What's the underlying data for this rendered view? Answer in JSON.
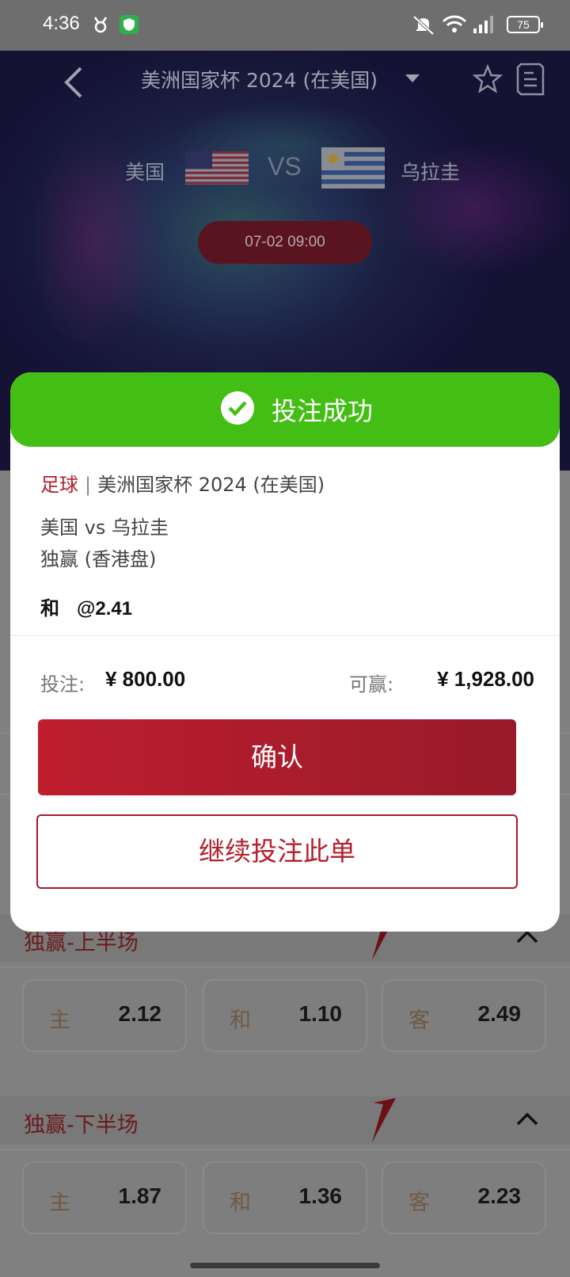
{
  "status_bar": {
    "time": "4:36",
    "battery": "75"
  },
  "header": {
    "league_title": "美洲国家杯 2024 (在美国)",
    "home_team": "美国",
    "vs": "VS",
    "away_team": "乌拉圭",
    "datetime": "07-02 09:00"
  },
  "modal": {
    "title": "投注成功",
    "sport": "足球",
    "separator": "|",
    "league": "美洲国家杯 2024 (在美国)",
    "match": "美国 vs 乌拉圭",
    "market": "独赢 (香港盘)",
    "selection": "和",
    "odds": "@2.41",
    "stake_label": "投注:",
    "stake_value": "¥ 800.00",
    "win_label": "可赢:",
    "win_value": "¥ 1,928.00",
    "confirm_label": "确认",
    "continue_label": "继续投注此单"
  },
  "markets": [
    {
      "title": "独赢-上半场",
      "odds": [
        {
          "label": "主",
          "value": "2.12"
        },
        {
          "label": "和",
          "value": "1.10"
        },
        {
          "label": "客",
          "value": "2.49"
        }
      ]
    },
    {
      "title": "独赢-下半场",
      "odds": [
        {
          "label": "主",
          "value": "1.87"
        },
        {
          "label": "和",
          "value": "1.36"
        },
        {
          "label": "客",
          "value": "2.23"
        }
      ]
    }
  ],
  "colors": {
    "success_green": "#43be14",
    "brand_red": "#b3202c"
  }
}
